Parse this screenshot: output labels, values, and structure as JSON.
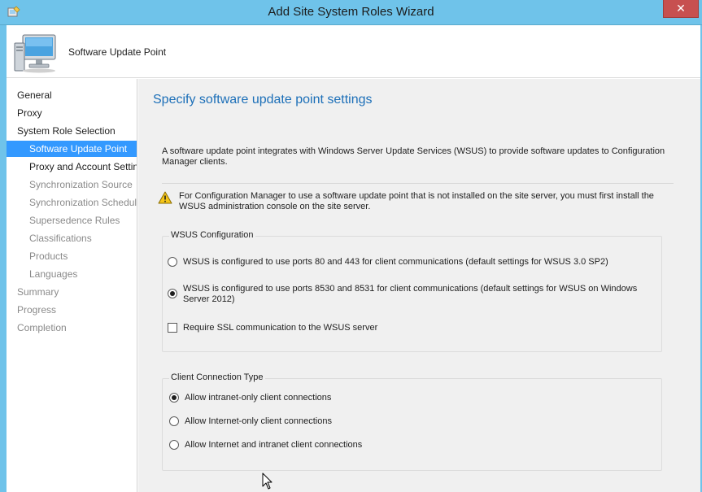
{
  "window": {
    "title": "Add Site System Roles Wizard",
    "close_label": "✕"
  },
  "header": {
    "title": "Software Update Point"
  },
  "nav": {
    "items": [
      {
        "label": "General",
        "state": "normal"
      },
      {
        "label": "Proxy",
        "state": "normal"
      },
      {
        "label": "System Role Selection",
        "state": "normal"
      },
      {
        "label": "Software Update Point",
        "state": "selected"
      },
      {
        "label": "Proxy and Account Settings",
        "state": "normal"
      },
      {
        "label": "Synchronization Source",
        "state": "disabled"
      },
      {
        "label": "Synchronization Schedule",
        "state": "disabled"
      },
      {
        "label": "Supersedence Rules",
        "state": "disabled"
      },
      {
        "label": "Classifications",
        "state": "disabled"
      },
      {
        "label": "Products",
        "state": "disabled"
      },
      {
        "label": "Languages",
        "state": "disabled"
      },
      {
        "label": "Summary",
        "state": "disabled"
      },
      {
        "label": "Progress",
        "state": "disabled"
      },
      {
        "label": "Completion",
        "state": "disabled"
      }
    ]
  },
  "main": {
    "page_title": "Specify software update point settings",
    "intro": "A software update point integrates with Windows Server Update Services (WSUS) to provide software updates to Configuration Manager clients.",
    "warning": "For Configuration Manager to use a software update point that is not installed on the site server, you must first install the WSUS administration console on the site server.",
    "wsus_config": {
      "title": "WSUS Configuration",
      "option_ports_80_443": "WSUS is configured to use ports 80 and 443 for client communications (default settings for WSUS 3.0 SP2)",
      "option_ports_8530_8531": "WSUS is configured to use ports 8530 and 8531 for client communications (default settings for WSUS on Windows Server 2012)",
      "selected": "ports_8530_8531",
      "require_ssl_label": "Require SSL communication to the WSUS server",
      "require_ssl_checked": false
    },
    "client_connection": {
      "title": "Client Connection Type",
      "option_intranet": "Allow intranet-only client connections",
      "option_internet": "Allow Internet-only client connections",
      "option_both": "Allow Internet and intranet client connections",
      "selected": "intranet"
    }
  },
  "colors": {
    "titlebar": "#6fc3ea",
    "accent_title": "#1c6fb8",
    "selection": "#3399ff",
    "close_button": "#c75050"
  }
}
